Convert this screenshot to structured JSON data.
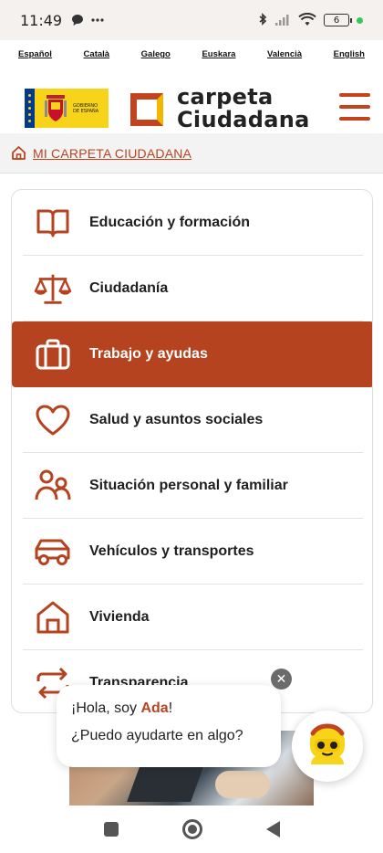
{
  "status_bar": {
    "time": "11:49",
    "battery": "6"
  },
  "languages": [
    "Español",
    "Català",
    "Galego",
    "Euskara",
    "Valencià",
    "English"
  ],
  "header": {
    "gov_logo_text": [
      "GOBIERNO",
      "DE ESPAÑA"
    ],
    "brand_line1": "carpeta",
    "brand_line2": "Ciudadana"
  },
  "breadcrumb": {
    "label": "MI CARPETA CIUDADANA"
  },
  "menu": {
    "items": [
      {
        "label": "Educación y formación",
        "icon": "book-icon",
        "active": false
      },
      {
        "label": "Ciudadanía",
        "icon": "scales-icon",
        "active": false
      },
      {
        "label": "Trabajo y ayudas",
        "icon": "briefcase-icon",
        "active": true
      },
      {
        "label": "Salud y asuntos sociales",
        "icon": "heart-icon",
        "active": false
      },
      {
        "label": "Situación personal y familiar",
        "icon": "people-icon",
        "active": false
      },
      {
        "label": "Vehículos y transportes",
        "icon": "car-icon",
        "active": false
      },
      {
        "label": "Vivienda",
        "icon": "house-icon",
        "active": false
      },
      {
        "label": "Transparencia",
        "icon": "transfer-arrows-icon",
        "active": false
      }
    ]
  },
  "chat": {
    "greeting_prefix": "¡Hola, soy ",
    "assistant_name": "Ada",
    "greeting_suffix": "!",
    "question": "¿Puedo ayudarte en algo?",
    "close_symbol": "✕"
  },
  "colors": {
    "accent": "#b5431f",
    "accent_text": "#b8451f",
    "breadcrumb_bg": "#f3f3f3",
    "gov_yellow": "#f7d31a"
  }
}
